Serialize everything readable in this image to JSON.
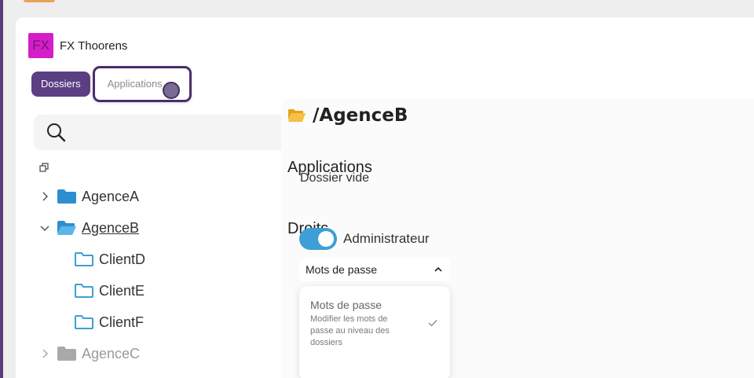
{
  "org": {
    "logo_text": "FX",
    "name": "FX Thoorens"
  },
  "tabs": [
    {
      "label": "Dossiers"
    },
    {
      "label": "Applications"
    }
  ],
  "search": {
    "placeholder": ""
  },
  "tree": [
    {
      "label": "AgenceA",
      "state": "collapsed"
    },
    {
      "label": "AgenceB",
      "state": "expanded",
      "selected": true
    },
    {
      "label": "ClientD"
    },
    {
      "label": "ClientE"
    },
    {
      "label": "ClientF"
    },
    {
      "label": "AgenceC",
      "state": "collapsed"
    }
  ],
  "main": {
    "path": "/AgenceB",
    "applications_title": "Applications",
    "applications_empty": "Dossier vide",
    "rights_title": "Droits",
    "admin_toggle": {
      "label": "Administrateur",
      "on": true
    },
    "select": {
      "value": "Mots de passe"
    },
    "dropdown": {
      "option_title": "Mots de passe",
      "option_desc": "Modifier les mots de passe au niveau des dossiers"
    }
  },
  "colors": {
    "brand_purple": "#5c3f82",
    "folder_blue": "#3d9fd6",
    "folder_yellow": "#f0b429",
    "toggle_blue": "#3d9fd6",
    "logo_magenta": "#d41ec9"
  }
}
